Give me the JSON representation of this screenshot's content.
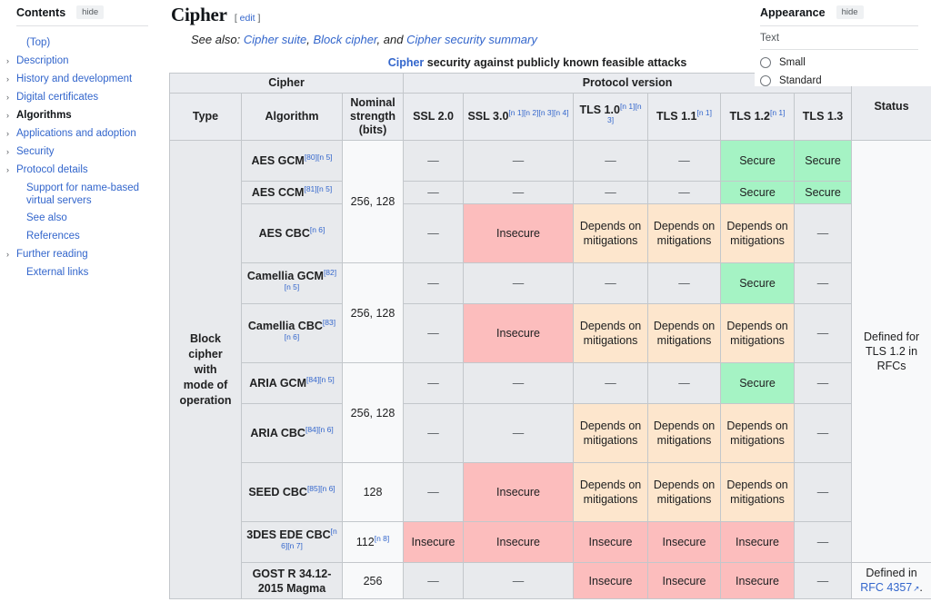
{
  "toc": {
    "title": "Contents",
    "hide_label": "hide",
    "items": [
      {
        "label": "(Top)",
        "expandable": false,
        "active": false,
        "indent": true
      },
      {
        "label": "Description",
        "expandable": true,
        "active": false,
        "indent": false
      },
      {
        "label": "History and development",
        "expandable": true,
        "active": false,
        "indent": false
      },
      {
        "label": "Digital certificates",
        "expandable": true,
        "active": false,
        "indent": false
      },
      {
        "label": "Algorithms",
        "expandable": true,
        "active": true,
        "indent": false
      },
      {
        "label": "Applications and adoption",
        "expandable": true,
        "active": false,
        "indent": false
      },
      {
        "label": "Security",
        "expandable": true,
        "active": false,
        "indent": false
      },
      {
        "label": "Protocol details",
        "expandable": true,
        "active": false,
        "indent": false
      },
      {
        "label": "Support for name-based virtual servers",
        "expandable": false,
        "active": false,
        "indent": true
      },
      {
        "label": "See also",
        "expandable": false,
        "active": false,
        "indent": true
      },
      {
        "label": "References",
        "expandable": false,
        "active": false,
        "indent": true
      },
      {
        "label": "Further reading",
        "expandable": true,
        "active": false,
        "indent": false
      },
      {
        "label": "External links",
        "expandable": false,
        "active": false,
        "indent": true
      }
    ]
  },
  "article": {
    "heading": "Cipher",
    "edit_open": "[",
    "edit_label": "edit",
    "edit_close": "]",
    "see_also_prefix": "See also:",
    "see_also_links": [
      "Cipher suite",
      "Block cipher",
      "Cipher security summary"
    ],
    "see_also_sep1": ",",
    "see_also_and": " and "
  },
  "appearance": {
    "title": "Appearance",
    "hide_label": "hide",
    "section_label": "Text",
    "options": [
      "Small",
      "Standard"
    ]
  },
  "table": {
    "caption_link": "Cipher",
    "caption_rest": " security against publicly known feasible attacks",
    "group_headers": [
      "Cipher",
      "Protocol version",
      "Status"
    ],
    "columns": [
      {
        "label": "Type",
        "refs": ""
      },
      {
        "label": "Algorithm",
        "refs": ""
      },
      {
        "label": "Nominal strength (bits)",
        "refs": ""
      },
      {
        "label": "SSL 2.0",
        "refs": ""
      },
      {
        "label": "SSL 3.0",
        "refs": "[n 1][n 2][n 3][n 4]"
      },
      {
        "label": "TLS 1.0",
        "refs": "[n 1][n 3]"
      },
      {
        "label": "TLS 1.1",
        "refs": "[n 1]"
      },
      {
        "label": "TLS 1.2",
        "refs": "[n 1]"
      },
      {
        "label": "TLS 1.3",
        "refs": ""
      },
      {
        "label": "Status",
        "refs": ""
      }
    ],
    "type_cell": {
      "lines": [
        "Block",
        "cipher",
        "with",
        "mode of",
        "operation"
      ],
      "plain_line_index": 2
    },
    "rows": [
      {
        "algorithm": "AES GCM",
        "algorithm_refs": "[80][n 5]",
        "strength": "256, 128",
        "strength_rowspan": 3,
        "cells": [
          {
            "text": "—",
            "state": "dash"
          },
          {
            "text": "—",
            "state": "dash"
          },
          {
            "text": "—",
            "state": "dash"
          },
          {
            "text": "—",
            "state": "dash"
          },
          {
            "text": "Secure",
            "state": "secure"
          },
          {
            "text": "Secure",
            "state": "secure"
          }
        ]
      },
      {
        "algorithm": "AES CCM",
        "algorithm_refs": "[81][n 5]",
        "cells": [
          {
            "text": "—",
            "state": "dash"
          },
          {
            "text": "—",
            "state": "dash"
          },
          {
            "text": "—",
            "state": "dash"
          },
          {
            "text": "—",
            "state": "dash"
          },
          {
            "text": "Secure",
            "state": "secure"
          },
          {
            "text": "Secure",
            "state": "secure"
          }
        ]
      },
      {
        "algorithm": "AES CBC",
        "algorithm_refs": "[n 6]",
        "cells": [
          {
            "text": "—",
            "state": "dash"
          },
          {
            "text": "Insecure",
            "state": "insecure"
          },
          {
            "text": "Depends on mitigations",
            "state": "depends"
          },
          {
            "text": "Depends on mitigations",
            "state": "depends"
          },
          {
            "text": "Depends on mitigations",
            "state": "depends"
          },
          {
            "text": "—",
            "state": "dash"
          }
        ]
      },
      {
        "algorithm": "Camellia GCM",
        "algorithm_refs": "[82][n 5]",
        "strength": "256, 128",
        "strength_rowspan": 2,
        "cells": [
          {
            "text": "—",
            "state": "dash"
          },
          {
            "text": "—",
            "state": "dash"
          },
          {
            "text": "—",
            "state": "dash"
          },
          {
            "text": "—",
            "state": "dash"
          },
          {
            "text": "Secure",
            "state": "secure"
          },
          {
            "text": "—",
            "state": "dash"
          }
        ]
      },
      {
        "algorithm": "Camellia CBC",
        "algorithm_refs": "[83][n 6]",
        "cells": [
          {
            "text": "—",
            "state": "dash"
          },
          {
            "text": "Insecure",
            "state": "insecure"
          },
          {
            "text": "Depends on mitigations",
            "state": "depends"
          },
          {
            "text": "Depends on mitigations",
            "state": "depends"
          },
          {
            "text": "Depends on mitigations",
            "state": "depends"
          },
          {
            "text": "—",
            "state": "dash"
          }
        ]
      },
      {
        "algorithm": "ARIA GCM",
        "algorithm_refs": "[84][n 5]",
        "strength": "256, 128",
        "strength_rowspan": 2,
        "cells": [
          {
            "text": "—",
            "state": "dash"
          },
          {
            "text": "—",
            "state": "dash"
          },
          {
            "text": "—",
            "state": "dash"
          },
          {
            "text": "—",
            "state": "dash"
          },
          {
            "text": "Secure",
            "state": "secure"
          },
          {
            "text": "—",
            "state": "dash"
          }
        ]
      },
      {
        "algorithm": "ARIA CBC",
        "algorithm_refs": "[84][n 6]",
        "cells": [
          {
            "text": "—",
            "state": "dash"
          },
          {
            "text": "—",
            "state": "dash"
          },
          {
            "text": "Depends on mitigations",
            "state": "depends"
          },
          {
            "text": "Depends on mitigations",
            "state": "depends"
          },
          {
            "text": "Depends on mitigations",
            "state": "depends"
          },
          {
            "text": "—",
            "state": "dash"
          }
        ]
      },
      {
        "algorithm": "SEED CBC",
        "algorithm_refs": "[85][n 6]",
        "strength": "128",
        "strength_rowspan": 1,
        "cells": [
          {
            "text": "—",
            "state": "dash"
          },
          {
            "text": "Insecure",
            "state": "insecure"
          },
          {
            "text": "Depends on mitigations",
            "state": "depends"
          },
          {
            "text": "Depends on mitigations",
            "state": "depends"
          },
          {
            "text": "Depends on mitigations",
            "state": "depends"
          },
          {
            "text": "—",
            "state": "dash"
          }
        ]
      },
      {
        "algorithm": "3DES EDE CBC",
        "algorithm_refs": "[n 6][n 7]",
        "strength": "112",
        "strength_refs": "[n 8]",
        "strength_rowspan": 1,
        "cells": [
          {
            "text": "Insecure",
            "state": "insecure"
          },
          {
            "text": "Insecure",
            "state": "insecure"
          },
          {
            "text": "Insecure",
            "state": "insecure"
          },
          {
            "text": "Insecure",
            "state": "insecure"
          },
          {
            "text": "Insecure",
            "state": "insecure"
          },
          {
            "text": "—",
            "state": "dash"
          }
        ]
      },
      {
        "algorithm": "GOST R 34.12-2015 Magma",
        "algorithm_refs": "",
        "strength": "256",
        "strength_rowspan": 1,
        "cells": [
          {
            "text": "—",
            "state": "dash"
          },
          {
            "text": "—",
            "state": "dash"
          },
          {
            "text": "Insecure",
            "state": "insecure"
          },
          {
            "text": "Insecure",
            "state": "insecure"
          },
          {
            "text": "Insecure",
            "state": "insecure"
          },
          {
            "text": "—",
            "state": "dash"
          }
        ]
      }
    ],
    "status_blocks": [
      {
        "text": "Defined for TLS 1.2 in RFCs",
        "link": "",
        "suffix": ""
      },
      {
        "text": "Defined in ",
        "link": "RFC 4357",
        "suffix": "."
      }
    ]
  },
  "colors": {
    "secure": "#a5f3c4",
    "insecure": "#fcbdbd",
    "depends": "#fde6cd",
    "neutral": "#e8eaed",
    "link": "#3366cc"
  }
}
